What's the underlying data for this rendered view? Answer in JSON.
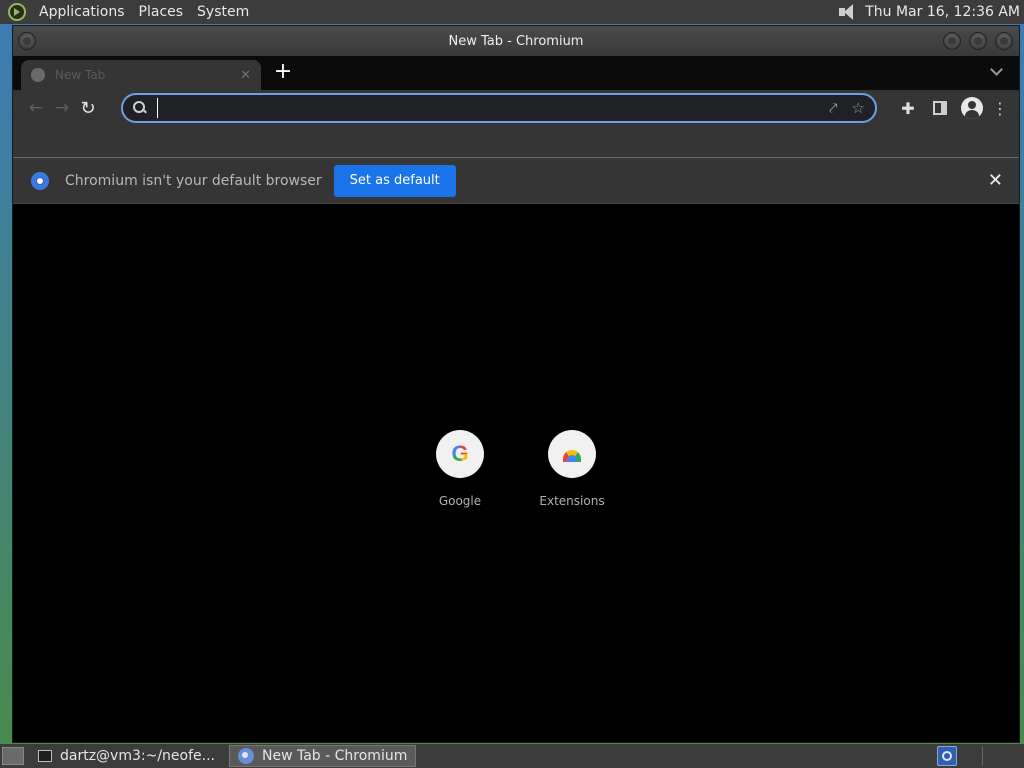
{
  "top_panel": {
    "menus": [
      "Applications",
      "Places",
      "System"
    ],
    "clock": "Thu Mar 16, 12:36 AM"
  },
  "window": {
    "title": "New Tab - Chromium"
  },
  "tabs": [
    {
      "title": "New Tab",
      "active": true
    }
  ],
  "toolbar": {
    "omnibox_value": ""
  },
  "infobar": {
    "message": "Chromium isn't your default browser",
    "button": "Set as default",
    "close_glyph": "✕"
  },
  "shortcuts": [
    {
      "label": "Google",
      "icon": "google-g-icon"
    },
    {
      "label": "Extensions",
      "icon": "chrome-web-store-icon"
    }
  ],
  "taskbar": {
    "tasks": [
      {
        "label": "dartz@vm3:~/neofe...",
        "icon": "terminal-icon"
      },
      {
        "label": "New Tab - Chromium",
        "icon": "chromium-icon",
        "active": true
      }
    ]
  },
  "colors": {
    "accent": "#1a73e8",
    "omnibox_border": "#6d9ee8",
    "panel": "#3c3c3c",
    "content_bg": "#000000"
  }
}
